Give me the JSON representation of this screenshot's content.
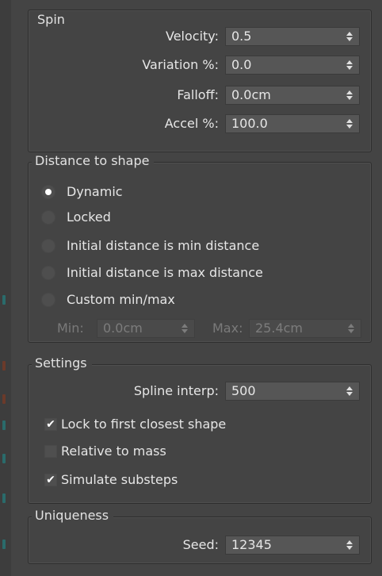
{
  "spin": {
    "title": "Spin",
    "velocity": {
      "label": "Velocity:",
      "value": "0.5"
    },
    "variation": {
      "label": "Variation %:",
      "value": "0.0"
    },
    "falloff": {
      "label": "Falloff:",
      "value": "0.0cm"
    },
    "accel": {
      "label": "Accel %:",
      "value": "100.0"
    }
  },
  "distance": {
    "title": "Distance to shape",
    "options": [
      {
        "label": "Dynamic",
        "selected": true
      },
      {
        "label": "Locked",
        "selected": false
      },
      {
        "label": "Initial distance is min distance",
        "selected": false
      },
      {
        "label": "Initial distance is max distance",
        "selected": false
      },
      {
        "label": "Custom min/max",
        "selected": false
      }
    ],
    "min": {
      "label": "Min:",
      "value": "0.0cm"
    },
    "max": {
      "label": "Max:",
      "value": "25.4cm"
    }
  },
  "settings": {
    "title": "Settings",
    "spline_interp": {
      "label": "Spline interp:",
      "value": "500"
    },
    "lock_to_first": {
      "label": "Lock to first closest shape",
      "checked": true
    },
    "relative_to_mass": {
      "label": "Relative to mass",
      "checked": false
    },
    "simulate_substeps": {
      "label": "Simulate substeps",
      "checked": true
    }
  },
  "uniqueness": {
    "title": "Uniqueness",
    "seed": {
      "label": "Seed:",
      "value": "12345"
    }
  },
  "colors": {
    "panel_bg": "#444444",
    "field_bg": "#565656",
    "text": "#e6e6e6",
    "disabled_text": "#7a7a7a"
  }
}
